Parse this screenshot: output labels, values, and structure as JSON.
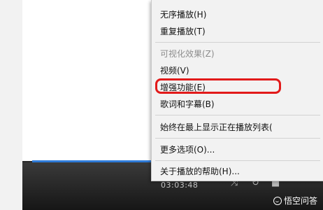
{
  "video": {
    "time": "03:03:48"
  },
  "watermark": {
    "text": "悟空问答"
  },
  "menu": {
    "items": [
      {
        "label": "无序播放(H)",
        "enabled": true
      },
      {
        "label": "重复播放(T)",
        "enabled": true
      },
      {
        "label": "可视化效果(Z)",
        "enabled": false
      },
      {
        "label": "视频(V)",
        "enabled": true
      },
      {
        "label": "增强功能(E)",
        "enabled": true,
        "highlighted": true
      },
      {
        "label": "歌词和字幕(B)",
        "enabled": true
      },
      {
        "label": "始终在最上显示正在播放列表(",
        "enabled": true
      },
      {
        "label": "更多选项(O)...",
        "enabled": true
      },
      {
        "label": "关于播放的帮助(H)...",
        "enabled": true
      }
    ]
  },
  "colors": {
    "highlight_ring": "#e21a1a",
    "progress": "#2f7bd8"
  }
}
